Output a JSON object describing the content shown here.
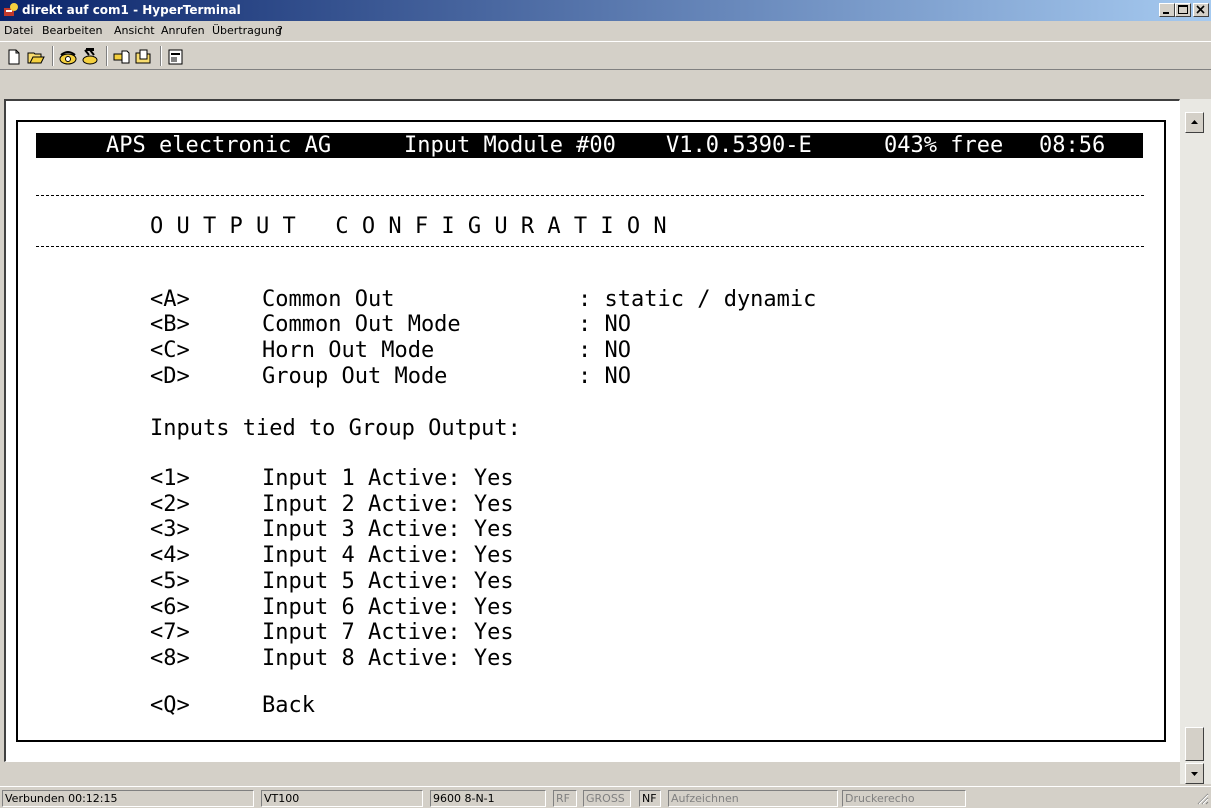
{
  "window": {
    "title": "direkt auf com1 - HyperTerminal"
  },
  "menu": [
    "Datei",
    "Bearbeiten",
    "Ansicht",
    "Anrufen",
    "Übertragung",
    "?"
  ],
  "toolbar": {
    "buttons": [
      "new-document-icon",
      "open-folder-icon",
      "connect-phone-icon",
      "disconnect-phone-icon",
      "send-file-icon",
      "receive-file-icon",
      "properties-icon"
    ]
  },
  "terminal": {
    "header": {
      "company": "APS electronic AG",
      "module": "Input Module #00",
      "version": "V1.0.5390-E",
      "free": "043% free",
      "time": "08:56"
    },
    "title": "O U T P U T   C O N F I G U R A T I O N",
    "config_items": [
      {
        "key": "<A>",
        "label": "Common Out",
        "value": ": static / dynamic"
      },
      {
        "key": "<B>",
        "label": "Common Out Mode",
        "value": ": NO"
      },
      {
        "key": "<C>",
        "label": "Horn Out Mode",
        "value": ": NO"
      },
      {
        "key": "<D>",
        "label": "Group Out Mode",
        "value": ": NO"
      }
    ],
    "inputs_title": "Inputs tied to Group Output:",
    "inputs": [
      {
        "key": "<1>",
        "label": "Input 1 Active: Yes"
      },
      {
        "key": "<2>",
        "label": "Input 2 Active: Yes"
      },
      {
        "key": "<3>",
        "label": "Input 3 Active: Yes"
      },
      {
        "key": "<4>",
        "label": "Input 4 Active: Yes"
      },
      {
        "key": "<5>",
        "label": "Input 5 Active: Yes"
      },
      {
        "key": "<6>",
        "label": "Input 6 Active: Yes"
      },
      {
        "key": "<7>",
        "label": "Input 7 Active: Yes"
      },
      {
        "key": "<8>",
        "label": "Input 8 Active: Yes"
      }
    ],
    "back": {
      "key": "<Q>",
      "label": "Back"
    }
  },
  "statusbar": {
    "connected": "Verbunden 00:12:15",
    "emulation": "VT100",
    "settings": "9600 8-N-1",
    "rf": "RF",
    "caps": "GROSS",
    "num": "NF",
    "capture": "Aufzeichnen",
    "print_echo": "Druckerecho"
  },
  "colors": {
    "titlebar_start": "#0a246a",
    "titlebar_end": "#a6caf0",
    "chrome": "#d4d0c8"
  }
}
